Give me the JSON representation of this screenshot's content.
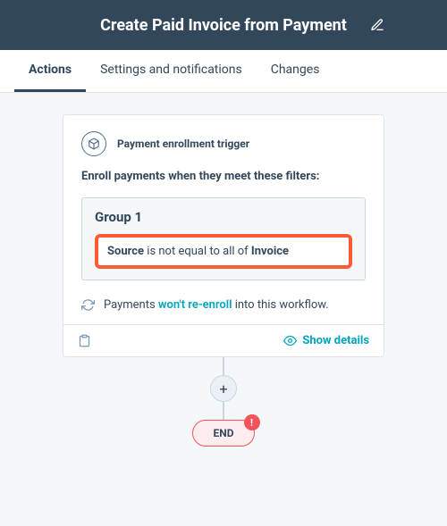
{
  "header": {
    "title": "Create Paid Invoice from Payment"
  },
  "tabs": [
    {
      "label": "Actions",
      "active": true
    },
    {
      "label": "Settings and notifications",
      "active": false
    },
    {
      "label": "Changes",
      "active": false
    }
  ],
  "trigger": {
    "label": "Payment enrollment trigger",
    "enroll_text": "Enroll payments when they meet these filters:",
    "group_title": "Group 1",
    "rule_field": "Source",
    "rule_middle": " is not equal to all of ",
    "rule_value": "Invoice"
  },
  "reenroll": {
    "prefix": "Payments ",
    "link": "won't re-enroll",
    "suffix": " into this workflow."
  },
  "footer": {
    "show_details": "Show details"
  },
  "nodes": {
    "plus": "+",
    "end": "END",
    "alert": "!"
  }
}
